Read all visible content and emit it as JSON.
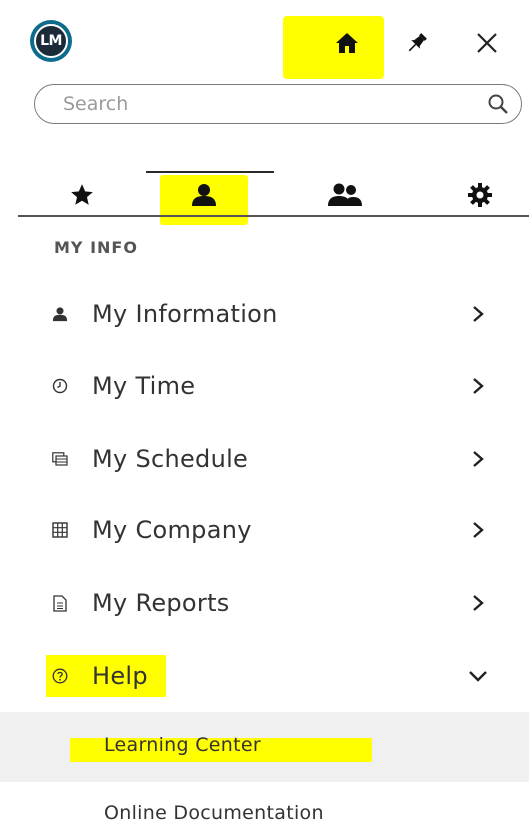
{
  "header": {
    "avatar_initials": "LM",
    "icons": [
      "home-icon",
      "pin-icon",
      "close-icon"
    ]
  },
  "search": {
    "placeholder": "Search"
  },
  "tabs": [
    {
      "icon": "star-icon",
      "active": false
    },
    {
      "icon": "person-icon",
      "active": true
    },
    {
      "icon": "people-icon",
      "active": false
    },
    {
      "icon": "gear-icon",
      "active": false
    }
  ],
  "section": {
    "title": "MY INFO"
  },
  "menu": {
    "items": [
      {
        "label": "My Information",
        "icon": "person-icon",
        "chevron": "right"
      },
      {
        "label": "My Time",
        "icon": "clock-icon",
        "chevron": "right"
      },
      {
        "label": "My Schedule",
        "icon": "schedule-icon",
        "chevron": "right"
      },
      {
        "label": "My Company",
        "icon": "grid-icon",
        "chevron": "right"
      },
      {
        "label": "My Reports",
        "icon": "report-icon",
        "chevron": "right"
      },
      {
        "label": "Help",
        "icon": "question-icon",
        "chevron": "down"
      }
    ],
    "help_sub": [
      {
        "label": "Learning Center"
      },
      {
        "label": "Online Documentation"
      }
    ]
  },
  "colors": {
    "highlight": "#ffff00",
    "avatar_ring": "#0e6b8c",
    "avatar_fill": "#1c2b3a",
    "text": "#333333"
  }
}
